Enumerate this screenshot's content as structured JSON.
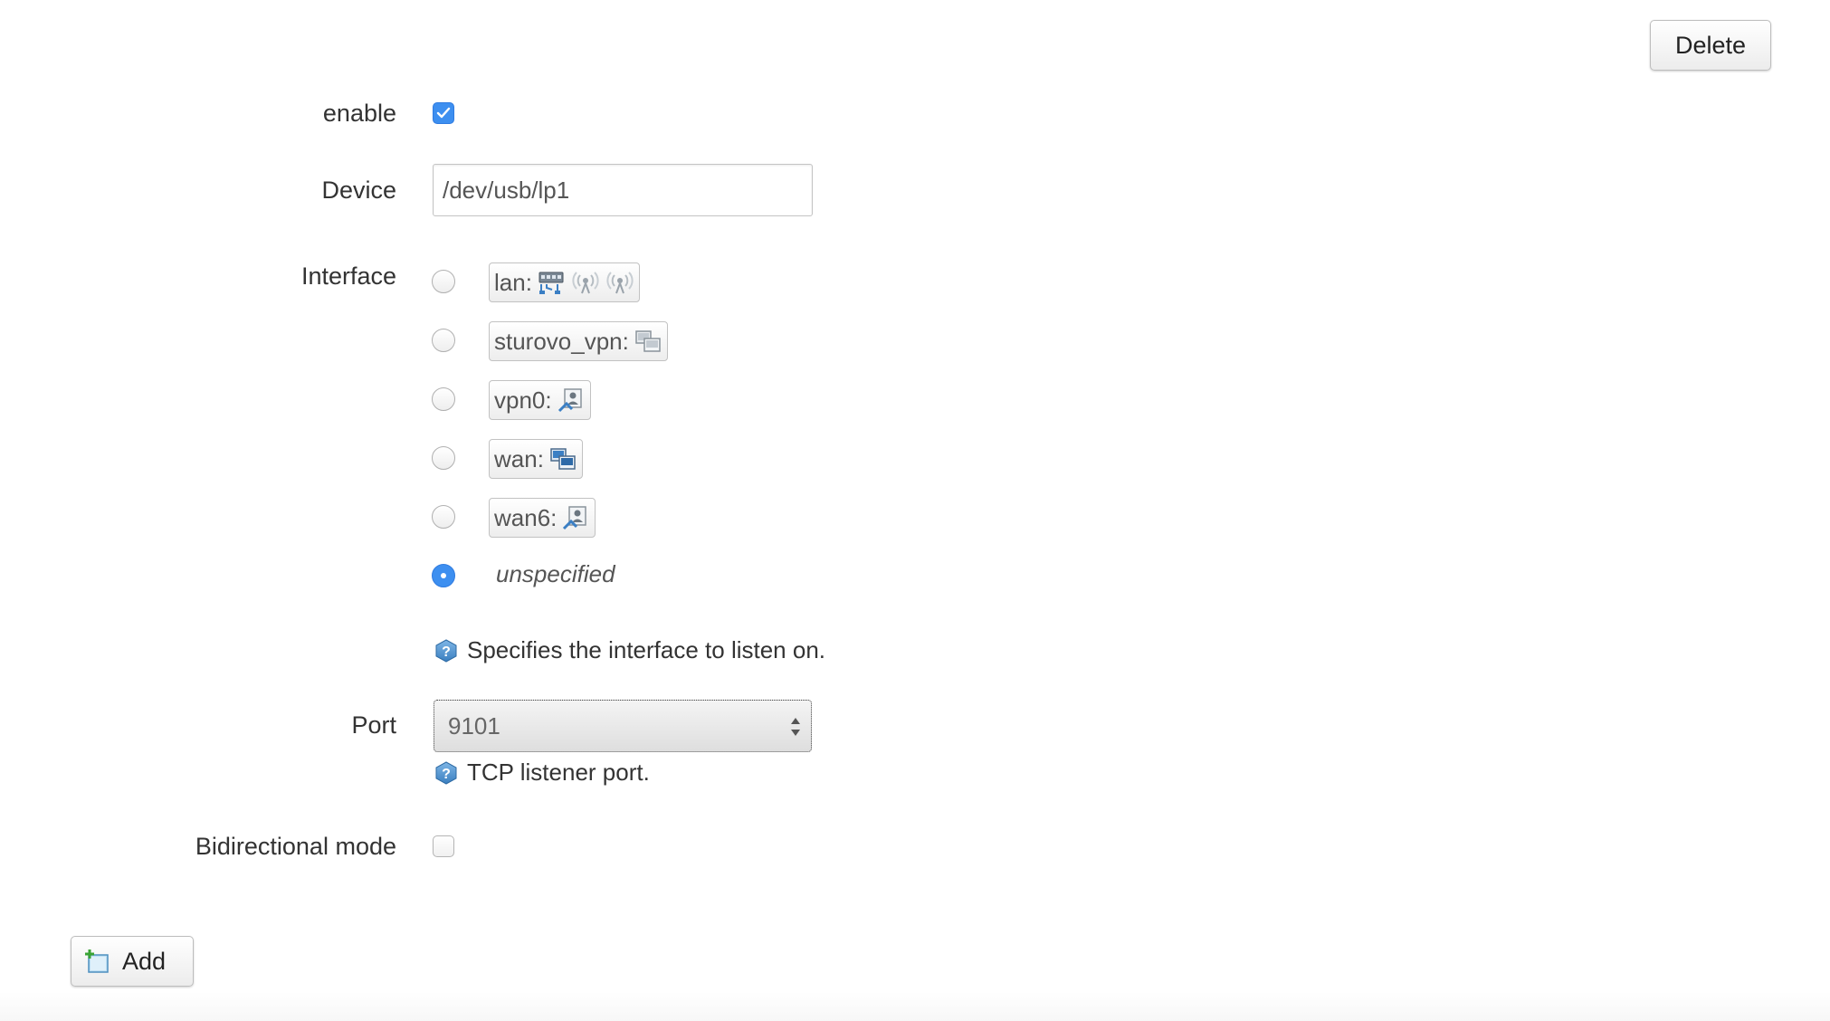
{
  "buttons": {
    "delete_label": "Delete",
    "add_label": "Add"
  },
  "form": {
    "enable": {
      "label": "enable",
      "checked": true
    },
    "device": {
      "label": "Device",
      "value": "/dev/usb/lp1"
    },
    "interface": {
      "label": "Interface",
      "options": [
        {
          "name": "lan:",
          "icons": [
            "ethernet-switch-icon",
            "wifi-disabled-icon",
            "wifi-disabled-icon"
          ],
          "selected": false
        },
        {
          "name": "sturovo_vpn:",
          "icons": [
            "tunnel-icon"
          ],
          "selected": false
        },
        {
          "name": "vpn0:",
          "icons": [
            "vpn-user-icon"
          ],
          "selected": false
        },
        {
          "name": "wan:",
          "icons": [
            "network-icon"
          ],
          "selected": false
        },
        {
          "name": "wan6:",
          "icons": [
            "vpn-user-icon"
          ],
          "selected": false
        }
      ],
      "unspecified_label": "unspecified",
      "unspecified_selected": true,
      "help": "Specifies the interface to listen on."
    },
    "port": {
      "label": "Port",
      "value": "9101",
      "help": "TCP listener port."
    },
    "bidirectional": {
      "label": "Bidirectional mode",
      "checked": false
    }
  },
  "colors": {
    "accent": "#3d8ff0",
    "help_icon": "#4a8fc8"
  }
}
